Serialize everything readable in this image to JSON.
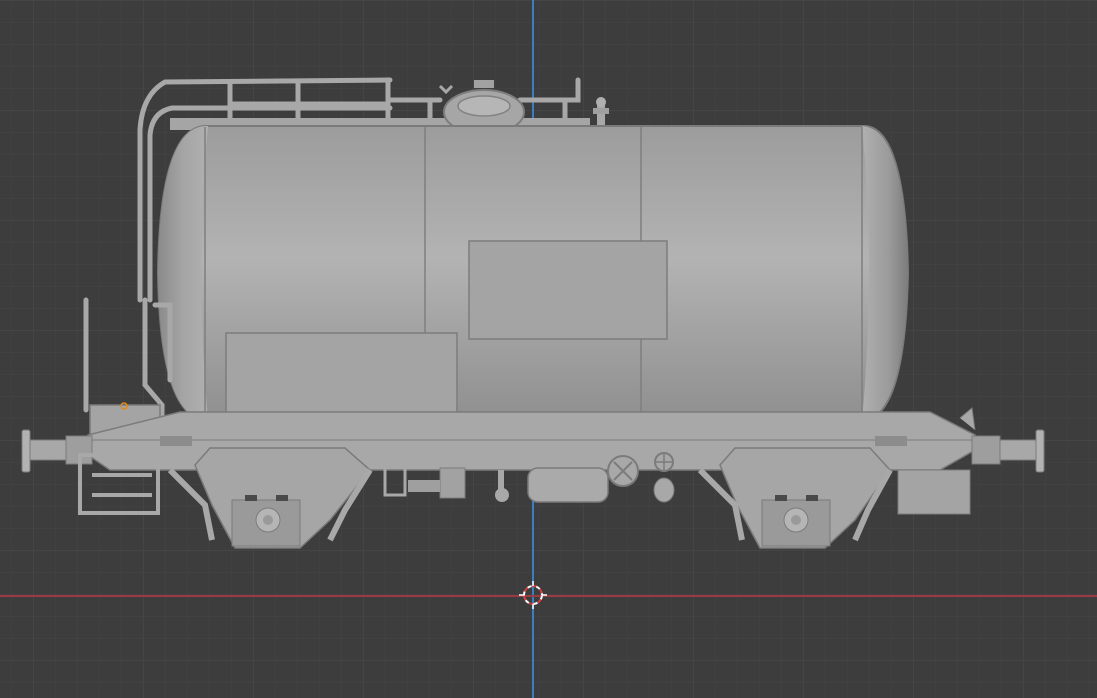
{
  "viewport": {
    "mode": "orthographic-side-view",
    "background_color": "#3d3d3d",
    "grid_color": "#454545",
    "y_axis_color": "#3b7fc2",
    "x_axis_color": "#9a3a43"
  },
  "model": {
    "subject": "tank-wagon",
    "body_color": "#a9a9a9",
    "shadow_color": "#8c8c8c",
    "outline_color": "#6e6e6e",
    "wheelsets": 2,
    "buffers": 4,
    "label_panels": 2
  },
  "gizmos": {
    "cursor_icon": "3d-cursor-icon",
    "origin_icon": "object-origin-icon",
    "origin_color": "#e08a1e"
  }
}
